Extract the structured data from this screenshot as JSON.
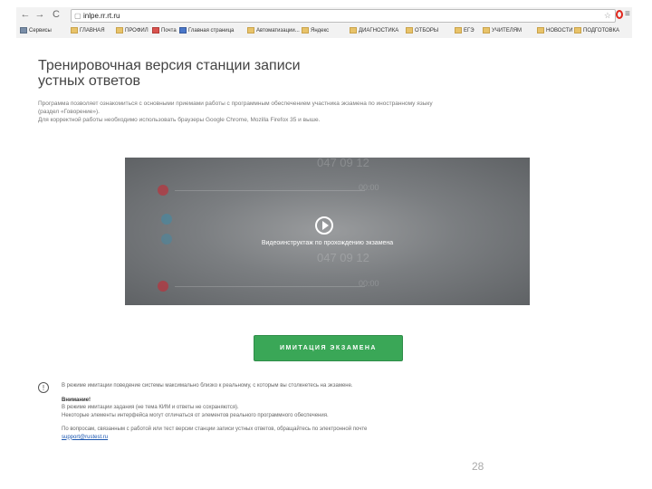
{
  "browser": {
    "address": "inlpe.rr.rt.ru",
    "bookmarks": [
      {
        "label": "Сервисы",
        "kind": "apps"
      },
      {
        "label": "ГЛАВНАЯ",
        "kind": "folder"
      },
      {
        "label": "ПРОФИЛ",
        "kind": "folder"
      },
      {
        "label": "Почта",
        "kind": "red"
      },
      {
        "label": "Главная страница",
        "kind": "blue"
      },
      {
        "label": "Автоматизации...",
        "kind": "folder"
      },
      {
        "label": "Яндекс",
        "kind": "folder"
      },
      {
        "label": "ДИАГНОСТИКА",
        "kind": "folder"
      },
      {
        "label": "ОТБОРЫ",
        "kind": "folder"
      },
      {
        "label": "ЕГЭ",
        "kind": "folder"
      },
      {
        "label": "УЧИТЕЛЯМ",
        "kind": "folder"
      },
      {
        "label": "НОВОСТИ",
        "kind": "folder"
      },
      {
        "label": "ПОДГОТОВКА",
        "kind": "folder"
      }
    ]
  },
  "page": {
    "title": "Тренировочная версия станции записи устных ответов",
    "description_1": "Программа позволяет ознакомиться с основными приемами работы с программным обеспечением участника экзамена по иностранному языку (раздел «Говорение»).",
    "description_2": "Для корректной работы необходимо использовать браузеры Google Chrome, Mozilla Firefox 35 и выше."
  },
  "video": {
    "caption": "Видеоинструктаж по прохождению экзамена",
    "ghost_numbers": [
      "047  09  12",
      "00:00",
      "047  09  12",
      "00:00"
    ]
  },
  "exam_button": {
    "label": "ИМИТАЦИЯ ЭКЗАМЕНА",
    "color": "#3aa757"
  },
  "notice": {
    "info_icon": "!",
    "line_1": "В режиме имитации поведение системы максимально близко к реальному, с которым вы столкнетесь на экзамене.",
    "attention": "Внимание!",
    "line_2": "В режиме имитации задания (не тема КИМ и ответы не сохраняются).",
    "line_3": "Некоторые элементы интерфейса могут отличаться от элементов реального программного обеспечения.",
    "line_4": "По вопросам, связанным с работой или тест версии станции записи устных ответов, обращайтесь по электронной почте",
    "email": "support@rustest.ru"
  },
  "slide_number": "28"
}
